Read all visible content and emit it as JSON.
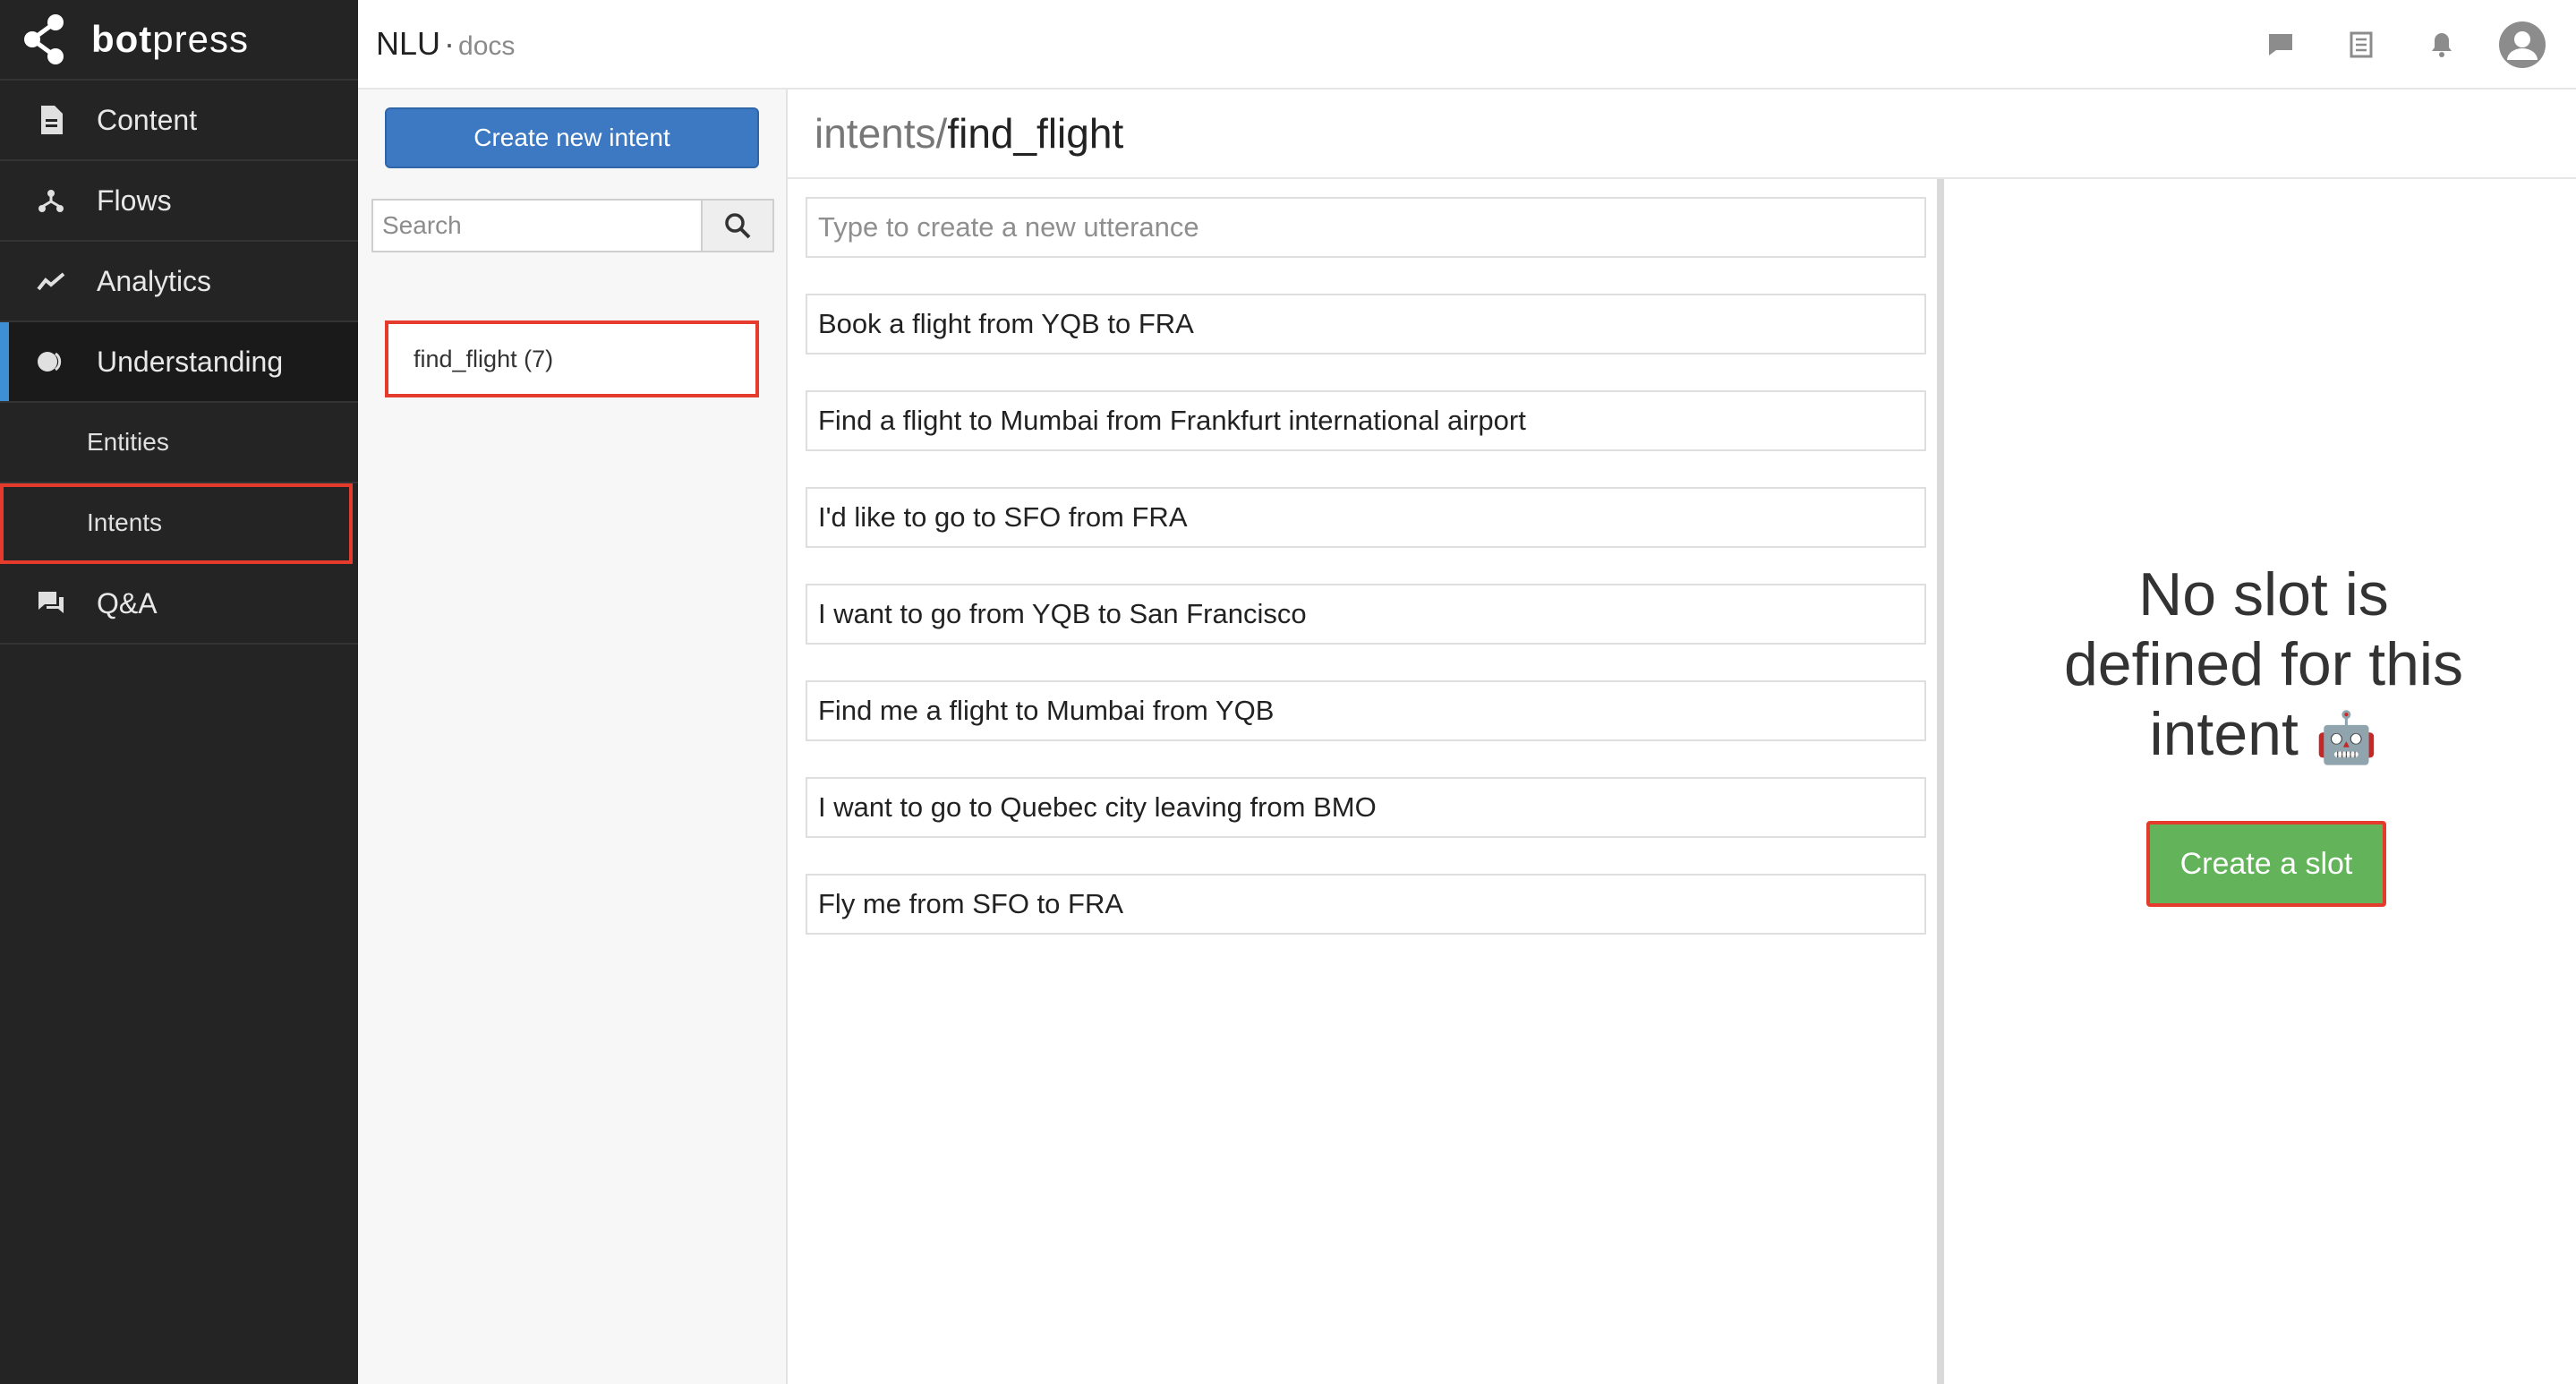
{
  "brand": {
    "name_bold": "bot",
    "name_rest": "press"
  },
  "header": {
    "title": "NLU",
    "separator": "·",
    "subtitle": "docs"
  },
  "sidebar": {
    "items": [
      {
        "label": "Content",
        "icon": "document-icon"
      },
      {
        "label": "Flows",
        "icon": "flow-icon"
      },
      {
        "label": "Analytics",
        "icon": "analytics-icon"
      },
      {
        "label": "Understanding",
        "icon": "understanding-icon"
      }
    ],
    "subitems": [
      {
        "label": "Entities"
      },
      {
        "label": "Intents"
      }
    ],
    "qa": {
      "label": "Q&A",
      "icon": "chat-icon"
    }
  },
  "intents": {
    "create_label": "Create new intent",
    "search_placeholder": "Search",
    "list": [
      {
        "label": "find_flight (7)"
      }
    ]
  },
  "utterances": {
    "header_path": "intents/",
    "header_name": "find_flight",
    "new_placeholder": "Type to create a new utterance",
    "items": [
      "Book a flight from YQB to FRA",
      "Find a flight to Mumbai from Frankfurt international airport",
      "I'd like to go to SFO from FRA",
      "I want to go from YQB to San Francisco",
      "Find me a flight to Mumbai from YQB",
      "I want to go to Quebec city leaving from BMO",
      "Fly me from SFO to FRA"
    ]
  },
  "slots": {
    "empty_line1": "No slot is",
    "empty_line2": "defined for this",
    "empty_line3": "intent",
    "emoji": "🤖",
    "create_label": "Create a slot"
  },
  "colors": {
    "accent": "#3d79c2",
    "highlight": "#e53b2c",
    "success": "#62b35a",
    "sidebar": "#242424"
  }
}
